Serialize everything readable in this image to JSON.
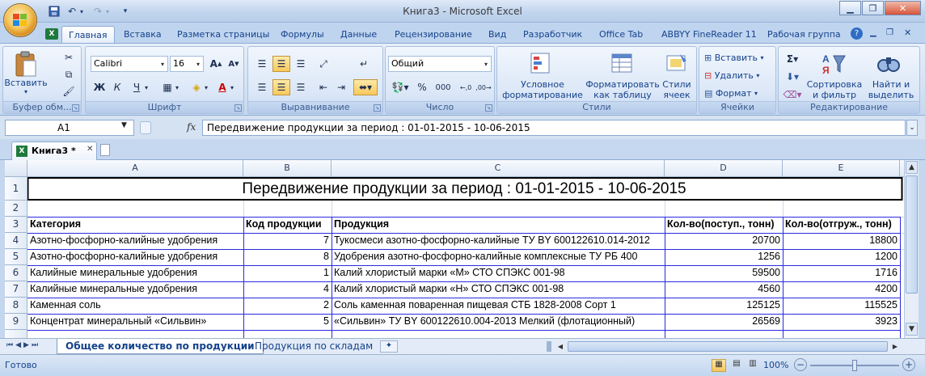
{
  "window": {
    "title": "Книга3 - Microsoft Excel"
  },
  "ribbon_tabs": [
    "Главная",
    "Вставка",
    "Разметка страницы",
    "Формулы",
    "Данные",
    "Рецензирование",
    "Вид",
    "Разработчик",
    "Office Tab",
    "ABBYY FineReader 11",
    "Рабочая группа"
  ],
  "ribbon": {
    "clipboard": {
      "label": "Буфер обм...",
      "paste": "Вставить"
    },
    "font": {
      "label": "Шрифт",
      "name": "Calibri",
      "size": "16",
      "bold": "Ж",
      "italic": "К",
      "underline": "Ч"
    },
    "alignment": {
      "label": "Выравнивание"
    },
    "number": {
      "label": "Число",
      "format": "Общий",
      "percent": "%",
      "thousands": "000"
    },
    "styles": {
      "label": "Стили",
      "conditional": "Условное\nформатирование",
      "as_table": "Форматировать\nкак таблицу",
      "cell_styles": "Стили\nячеек"
    },
    "cells": {
      "label": "Ячейки",
      "insert": "Вставить",
      "delete": "Удалить",
      "format": "Формат"
    },
    "editing": {
      "label": "Редактирование",
      "sort": "Сортировка\nи фильтр",
      "find": "Найти и\nвыделить"
    }
  },
  "formula_bar": {
    "cell_ref": "A1",
    "fx": "fx",
    "formula": "Передвижение продукции за период : 01-01-2015 - 10-06-2015"
  },
  "doc_tab": {
    "name": "Книга3 *"
  },
  "sheet": {
    "columns": [
      "A",
      "B",
      "C",
      "D",
      "E"
    ],
    "rows": [
      "1",
      "2",
      "3",
      "4",
      "5",
      "6",
      "7",
      "8",
      "9"
    ],
    "title": "Передвижение продукции за период : 01-01-2015 - 10-06-2015",
    "headers": [
      "Категория",
      "Код продукции",
      "Продукция",
      "Кол-во(поступ., тонн)",
      "Кол-во(отгруж., тонн)"
    ],
    "data": [
      [
        "Азотно-фосфорно-калийные удобрения",
        "7",
        "Тукосмеси азотно-фосфорно-калийные  ТУ BY 600122610.014-2012",
        "20700",
        "18800"
      ],
      [
        "Азотно-фосфорно-калийные удобрения",
        "8",
        "Удобрения азотно-фосфорно-калийные комплексные  ТУ РБ 400",
        "1256",
        "1200"
      ],
      [
        "Калийные минеральные удобрения",
        "1",
        "Калий хлористый марки «М» СТО СПЭКС 001-98",
        "59500",
        "1716"
      ],
      [
        "Калийные минеральные удобрения",
        "4",
        "Калий хлористый марки «Н» СТО СПЭКС 001-98",
        "4560",
        "4200"
      ],
      [
        "Каменная соль",
        "2",
        "Соль каменная поваренная пищевая СТБ  1828-2008 Сорт 1",
        "125125",
        "115525"
      ],
      [
        "Концентрат минеральный «Сильвин»",
        "5",
        "«Сильвин» ТУ BY 600122610.004-2013 Мелкий (флотационный)",
        "26569",
        "3923"
      ]
    ]
  },
  "sheet_tabs": [
    "Общее количество по продукции",
    "Продукция по складам"
  ],
  "status": {
    "ready": "Готово",
    "zoom": "100%"
  }
}
